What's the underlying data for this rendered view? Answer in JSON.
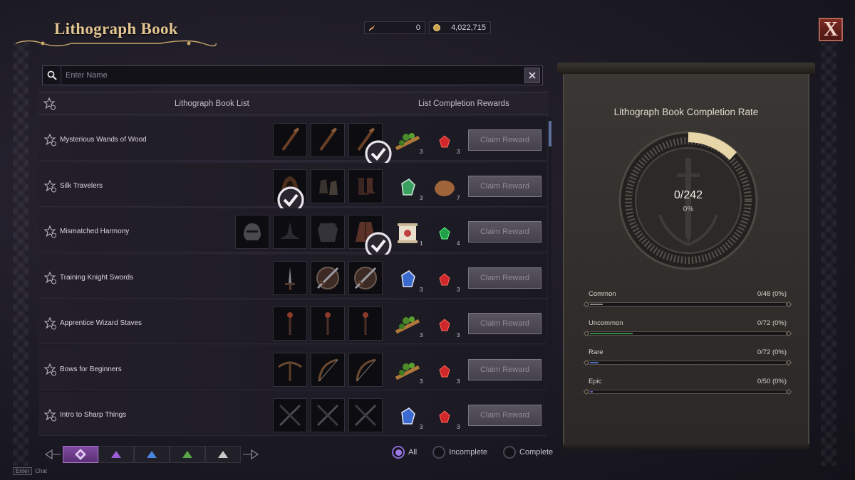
{
  "header": {
    "title": "Lithograph Book",
    "currency": [
      {
        "icon": "silver-feather-icon",
        "value": "0"
      },
      {
        "icon": "gold-coin-icon",
        "value": "4,022,715"
      }
    ],
    "close_label": "X"
  },
  "search": {
    "placeholder": "Enter Name",
    "value": ""
  },
  "list_header": {
    "list_label": "Lithograph Book List",
    "rewards_label": "List Completion Rewards"
  },
  "rows": [
    {
      "name": "Mysterious Wands of Wood",
      "items": [
        "wand-icon",
        "wand-icon",
        "wand-icon"
      ],
      "checked": [
        2
      ],
      "rewards": [
        {
          "icon": "wood-branch-icon",
          "count": "3"
        },
        {
          "icon": "red-gem-icon",
          "count": "3"
        }
      ],
      "claim_label": "Claim Reward"
    },
    {
      "name": "Silk Travelers",
      "items": [
        "hood-icon",
        "gloves-icon",
        "boots-icon"
      ],
      "checked": [
        0
      ],
      "rewards": [
        {
          "icon": "green-crystal-icon",
          "count": "3"
        },
        {
          "icon": "leather-icon",
          "count": "7"
        }
      ],
      "claim_label": "Claim Reward"
    },
    {
      "name": "Mismatched Harmony",
      "items": [
        "helmet-icon",
        "hat-icon",
        "armor-icon",
        "robe-icon"
      ],
      "checked": [
        3
      ],
      "rewards": [
        {
          "icon": "scroll-icon",
          "count": "1"
        },
        {
          "icon": "green-gem-icon",
          "count": "4"
        }
      ],
      "claim_label": "Claim Reward"
    },
    {
      "name": "Training Knight Swords",
      "items": [
        "sword-icon",
        "sword-shield-icon",
        "sword-shield-icon"
      ],
      "checked": [],
      "rewards": [
        {
          "icon": "blue-crystal-icon",
          "count": "3"
        },
        {
          "icon": "red-gem-icon",
          "count": "3"
        }
      ],
      "claim_label": "Claim Reward"
    },
    {
      "name": "Apprentice Wizard Staves",
      "items": [
        "staff-icon",
        "staff-icon",
        "staff-icon"
      ],
      "checked": [],
      "rewards": [
        {
          "icon": "wood-branch-icon",
          "count": "3"
        },
        {
          "icon": "red-gem-icon",
          "count": "3"
        }
      ],
      "claim_label": "Claim Reward"
    },
    {
      "name": "Bows for Beginners",
      "items": [
        "crossbow-icon",
        "bow-icon",
        "bow-icon"
      ],
      "checked": [],
      "rewards": [
        {
          "icon": "wood-branch-icon",
          "count": "3"
        },
        {
          "icon": "red-gem-icon",
          "count": "3"
        }
      ],
      "claim_label": "Claim Reward"
    },
    {
      "name": "Intro to Sharp Things",
      "items": [
        "dual-blades-icon",
        "dual-blades-icon",
        "dual-blades-icon"
      ],
      "checked": [],
      "rewards": [
        {
          "icon": "blue-crystal-icon",
          "count": "3"
        },
        {
          "icon": "red-gem-icon",
          "count": "3"
        }
      ],
      "claim_label": "Claim Reward"
    }
  ],
  "grade_tabs": [
    {
      "name": "all-grades",
      "color": "#e0c8f0"
    },
    {
      "name": "epic",
      "color": "#9a5ed6"
    },
    {
      "name": "rare",
      "color": "#4a86e0"
    },
    {
      "name": "uncommon",
      "color": "#5aa64a"
    },
    {
      "name": "common",
      "color": "#c8c8c8"
    }
  ],
  "filters": [
    {
      "label": "All",
      "selected": true
    },
    {
      "label": "Incomplete",
      "selected": false
    },
    {
      "label": "Complete",
      "selected": false
    }
  ],
  "chat": {
    "key": "Enter",
    "label": "Chat"
  },
  "completion": {
    "title": "Lithograph Book Completion Rate",
    "count": "0/242",
    "percent": "0%",
    "grades": [
      {
        "label": "Common",
        "value": "0/48 (0%)",
        "color": "#8a8a8a"
      },
      {
        "label": "Uncommon",
        "value": "0/72 (0%)",
        "color": "#3f8a4a"
      },
      {
        "label": "Rare",
        "value": "0/72 (0%)",
        "color": "#4f6fbf"
      },
      {
        "label": "Epic",
        "value": "0/50 (0%)",
        "color": "#7a4fb5"
      }
    ]
  }
}
